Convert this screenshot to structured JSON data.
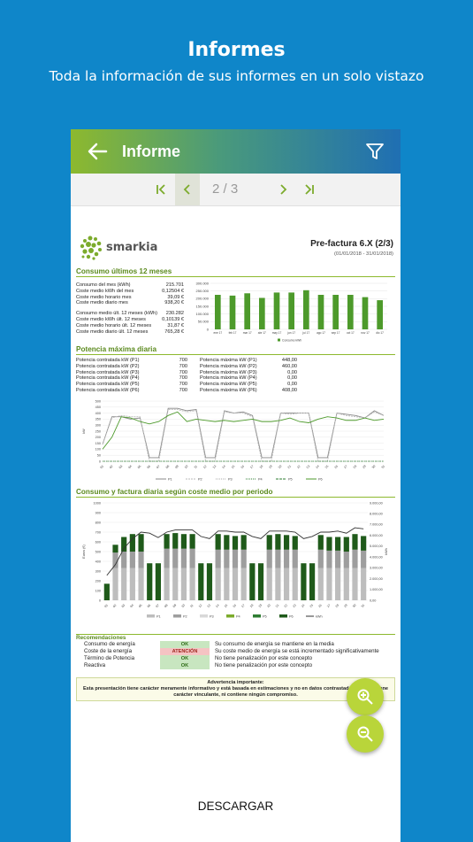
{
  "hero": {
    "title": "Informes",
    "subtitle": "Toda la información de sus informes en un solo vistazo"
  },
  "appbar": {
    "title": "Informe",
    "icons": [
      "arrow-left-icon",
      "filter-icon"
    ]
  },
  "pager": {
    "page": "2 / 3"
  },
  "report": {
    "brand": "smarkia",
    "title": "Pre-factura 6.X (2/3)",
    "period": "(01/01/2018 - 31/01/2018)",
    "consumo_section": "Consumo últimos 12 meses",
    "consumo_rows": [
      {
        "label": "Consumo del mes (kWh)",
        "value": "215.701"
      },
      {
        "label": "Coste medio kWh del mes",
        "value": "0,12504 €"
      },
      {
        "label": "Coste medio horario mes",
        "value": "39,09 €"
      },
      {
        "label": "Coste medio diario mes",
        "value": "938,20 €"
      }
    ],
    "consumo_rows2": [
      {
        "label": "Consumo medio últ. 12 meses (kWh)",
        "value": "230.282"
      },
      {
        "label": "Coste medio kWh últ. 12 meses",
        "value": "0,10139 €"
      },
      {
        "label": "Coste medio horario últ. 12 meses",
        "value": "31,87 €"
      },
      {
        "label": "Coste medio diario últ. 12 meses",
        "value": "765,28 €"
      }
    ],
    "potencia_section": "Potencia máxima diaria",
    "potencia_contratada": [
      {
        "label": "Potencia contratada kW (P1)",
        "value": "700"
      },
      {
        "label": "Potencia contratada kW (P2)",
        "value": "700"
      },
      {
        "label": "Potencia contratada kW (P3)",
        "value": "700"
      },
      {
        "label": "Potencia contratada kW (P4)",
        "value": "700"
      },
      {
        "label": "Potencia contratada kW (P5)",
        "value": "700"
      },
      {
        "label": "Potencia contratada kW (P6)",
        "value": "700"
      }
    ],
    "potencia_maxima": [
      {
        "label": "Potencia máxima kW (P1)",
        "value": "448,00"
      },
      {
        "label": "Potencia máxima kW (P2)",
        "value": "460,00"
      },
      {
        "label": "Potencia máxima kW (P3)",
        "value": "0,00"
      },
      {
        "label": "Potencia máxima kW (P4)",
        "value": "0,00"
      },
      {
        "label": "Potencia máxima kW (P5)",
        "value": "0,00"
      },
      {
        "label": "Potencia máxima kW (P6)",
        "value": "408,00"
      }
    ],
    "factura_section": "Consumo y factura diaria según coste medio por periodo",
    "rec_section": "Recomendaciones",
    "recs": [
      {
        "label": "Consumo de energía",
        "status": "OK",
        "text": "Su consumo de energía se mantiene en la media"
      },
      {
        "label": "Coste de la energía",
        "status": "ATENCIÓN",
        "text": "Su coste medio de energía se está incrementado significativamente"
      },
      {
        "label": "Término de Potencia",
        "status": "OK",
        "text": "No tiene penalización por este concepto"
      },
      {
        "label": "Reactiva",
        "status": "OK",
        "text": "No tiene penalización por este concepto"
      }
    ],
    "warning_title": "Advertencia importante:",
    "warning_text": "Esta presentación tiene carácter meramente informativo y está basada en estimaciones y no en datos contrastados. Éste no tiene carácter vinculante, ni contiene ningún compromiso."
  },
  "download_label": "DESCARGAR",
  "colors": {
    "green": "#7cab2c",
    "blue": "#0f86c9",
    "fab": "#b9d53a"
  },
  "chart_data": [
    {
      "type": "bar",
      "categories": [
        "ene 17",
        "feb 17",
        "mar 17",
        "abr 17",
        "may 17",
        "jun 17",
        "jul 17",
        "ago 17",
        "sep 17",
        "oct 17",
        "nov 17",
        "dic 17"
      ],
      "series": [
        {
          "name": "Consumo kWh",
          "values": [
            225000,
            220000,
            235000,
            205000,
            240000,
            240000,
            255000,
            225000,
            225000,
            225000,
            210000,
            190000
          ]
        }
      ],
      "ylim": [
        0,
        300000
      ],
      "yticks": [
        "0",
        "50.000",
        "100.000",
        "150.000",
        "200.000",
        "250.000",
        "300.000"
      ],
      "grid": true,
      "legend": "bottom"
    },
    {
      "type": "line",
      "x": [
        1,
        2,
        3,
        4,
        5,
        6,
        7,
        8,
        9,
        10,
        11,
        12,
        13,
        14,
        15,
        16,
        17,
        18,
        19,
        20,
        21,
        22,
        23,
        24,
        25,
        26,
        27,
        28,
        29,
        30,
        31
      ],
      "xticks": [
        "01",
        "02",
        "03",
        "04",
        "05",
        "06",
        "07",
        "08",
        "09",
        "10",
        "11",
        "12",
        "13",
        "14",
        "15",
        "16",
        "17",
        "18",
        "19",
        "20",
        "21",
        "22",
        "23",
        "24",
        "25",
        "26",
        "27",
        "28",
        "29",
        "30",
        "31"
      ],
      "ylabel": "kW",
      "ylim": [
        0,
        500
      ],
      "yticks": [
        "0",
        "50",
        "100",
        "150",
        "200",
        "250",
        "300",
        "350",
        "400",
        "450",
        "500"
      ],
      "series": [
        {
          "name": "P1",
          "values": [
            140,
            370,
            370,
            350,
            360,
            30,
            30,
            440,
            440,
            420,
            430,
            30,
            30,
            420,
            400,
            410,
            380,
            30,
            30,
            400,
            400,
            400,
            400,
            30,
            30,
            400,
            390,
            380,
            360,
            420,
            380
          ]
        },
        {
          "name": "P2",
          "values": [
            140,
            360,
            380,
            370,
            370,
            0,
            0,
            430,
            430,
            410,
            420,
            0,
            0,
            410,
            400,
            400,
            370,
            0,
            0,
            400,
            390,
            400,
            400,
            0,
            0,
            400,
            380,
            370,
            360,
            410,
            380
          ]
        },
        {
          "name": "P3",
          "values": [
            0,
            0,
            0,
            0,
            0,
            0,
            0,
            0,
            0,
            0,
            0,
            0,
            0,
            0,
            0,
            0,
            0,
            0,
            0,
            0,
            0,
            0,
            0,
            0,
            0,
            0,
            0,
            0,
            0,
            0,
            0
          ]
        },
        {
          "name": "P4",
          "values": [
            0,
            0,
            0,
            0,
            0,
            0,
            0,
            0,
            0,
            0,
            0,
            0,
            0,
            0,
            0,
            0,
            0,
            0,
            0,
            0,
            0,
            0,
            0,
            0,
            0,
            0,
            0,
            0,
            0,
            0,
            0
          ]
        },
        {
          "name": "P5",
          "values": [
            0,
            0,
            0,
            0,
            0,
            0,
            0,
            0,
            0,
            0,
            0,
            0,
            0,
            0,
            0,
            0,
            0,
            0,
            0,
            0,
            0,
            0,
            0,
            0,
            0,
            0,
            0,
            0,
            0,
            0,
            0
          ]
        },
        {
          "name": "P6",
          "values": [
            100,
            200,
            370,
            360,
            330,
            310,
            330,
            380,
            410,
            330,
            350,
            340,
            330,
            340,
            330,
            340,
            350,
            330,
            330,
            340,
            360,
            330,
            320,
            350,
            370,
            360,
            340,
            340,
            360,
            340,
            350
          ]
        }
      ],
      "grid": true,
      "legend": "bottom"
    },
    {
      "type": "bar",
      "x": [
        1,
        2,
        3,
        4,
        5,
        6,
        7,
        8,
        9,
        10,
        11,
        12,
        13,
        14,
        15,
        16,
        17,
        18,
        19,
        20,
        21,
        22,
        23,
        24,
        25,
        26,
        27,
        28,
        29,
        30,
        31
      ],
      "xticks": [
        "01",
        "02",
        "03",
        "04",
        "05",
        "06",
        "07",
        "08",
        "09",
        "10",
        "11",
        "12",
        "13",
        "14",
        "15",
        "16",
        "17",
        "18",
        "19",
        "20",
        "21",
        "22",
        "23",
        "24",
        "25",
        "26",
        "27",
        "28",
        "29",
        "30",
        "31"
      ],
      "ylabel": "Euros (€)",
      "ylim": [
        0,
        1000
      ],
      "yticks": [
        "0",
        "100",
        "200",
        "300",
        "400",
        "500",
        "600",
        "700",
        "800",
        "900",
        "1000"
      ],
      "y2label": "kWh",
      "y2lim": [
        0,
        9000
      ],
      "y2ticks": [
        "0,00",
        "1.000,00",
        "2.000,00",
        "3.000,00",
        "4.000,00",
        "5.000,00",
        "6.000,00",
        "7.000,00",
        "8.000,00",
        "9.000,00"
      ],
      "series": [
        {
          "name": "P1",
          "values": [
            0,
            330,
            330,
            330,
            330,
            0,
            0,
            330,
            330,
            330,
            330,
            0,
            0,
            330,
            330,
            330,
            330,
            0,
            0,
            330,
            330,
            330,
            330,
            0,
            0,
            330,
            330,
            330,
            330,
            330,
            330
          ]
        },
        {
          "name": "P2",
          "values": [
            0,
            160,
            170,
            170,
            170,
            0,
            0,
            200,
            200,
            200,
            200,
            0,
            0,
            190,
            190,
            190,
            190,
            0,
            0,
            190,
            190,
            190,
            190,
            0,
            0,
            190,
            180,
            180,
            170,
            190,
            180
          ]
        },
        {
          "name": "P3",
          "values": [
            0,
            0,
            0,
            0,
            0,
            0,
            0,
            0,
            0,
            0,
            0,
            0,
            0,
            0,
            0,
            0,
            0,
            0,
            0,
            0,
            0,
            0,
            0,
            0,
            0,
            0,
            0,
            0,
            0,
            0,
            0
          ]
        },
        {
          "name": "P4",
          "values": [
            0,
            0,
            0,
            0,
            0,
            0,
            0,
            0,
            0,
            0,
            0,
            0,
            0,
            0,
            0,
            0,
            0,
            0,
            0,
            0,
            0,
            0,
            0,
            0,
            0,
            0,
            0,
            0,
            0,
            0,
            0
          ]
        },
        {
          "name": "P5",
          "values": [
            0,
            0,
            0,
            0,
            0,
            0,
            0,
            0,
            0,
            0,
            0,
            0,
            0,
            0,
            0,
            0,
            0,
            0,
            0,
            0,
            0,
            0,
            0,
            0,
            0,
            0,
            0,
            0,
            0,
            0,
            0
          ]
        },
        {
          "name": "P6",
          "values": [
            170,
            80,
            150,
            180,
            180,
            380,
            380,
            150,
            160,
            150,
            150,
            380,
            380,
            160,
            150,
            140,
            150,
            380,
            380,
            150,
            160,
            150,
            140,
            380,
            380,
            150,
            140,
            140,
            150,
            160,
            150
          ]
        },
        {
          "name": "kWh",
          "values": [
            2300,
            3300,
            4800,
            5700,
            6300,
            6200,
            5800,
            6300,
            6500,
            6500,
            6500,
            5900,
            5700,
            6400,
            6400,
            6300,
            6300,
            5900,
            5700,
            6400,
            6400,
            6400,
            6300,
            5700,
            5900,
            6300,
            6300,
            6400,
            6200,
            6700,
            6600
          ]
        }
      ],
      "grid": true,
      "legend": "bottom"
    }
  ]
}
